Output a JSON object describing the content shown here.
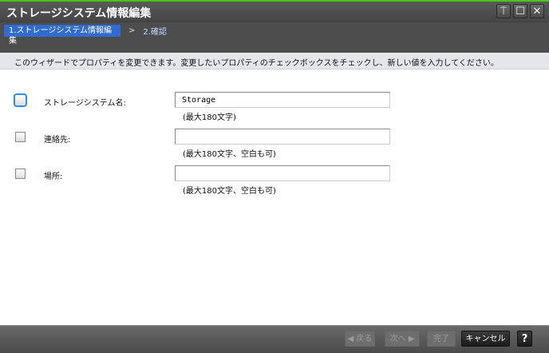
{
  "window": {
    "title": "ストレージシステム情報編集",
    "buttons": {
      "pin": "⍑",
      "maximize": "☐",
      "close": "✕"
    }
  },
  "steps": {
    "active": "1.ストレージシステム情報編集",
    "separator": ">",
    "next": "2.確認"
  },
  "instruction": "このウィザードでプロパティを変更できます。変更したいプロパティのチェックボックスをチェックし、新しい値を入力してください。",
  "fields": [
    {
      "label": "ストレージシステム名:",
      "value": "Storage",
      "hint": "(最大180文字)",
      "checked": false
    },
    {
      "label": "連絡先:",
      "value": "",
      "hint": "(最大180文字、空白も可)",
      "checked": false
    },
    {
      "label": "場所:",
      "value": "",
      "hint": "(最大180文字、空白も可)",
      "checked": false
    }
  ],
  "footer": {
    "back": "◀ 戻る",
    "next": "次へ ▶",
    "finish": "完了",
    "cancel": "キャンセル",
    "help": "?"
  },
  "colors": {
    "accent": "#2f6bd0",
    "focus": "#2b8cf0",
    "topline": "#4fc21a"
  }
}
